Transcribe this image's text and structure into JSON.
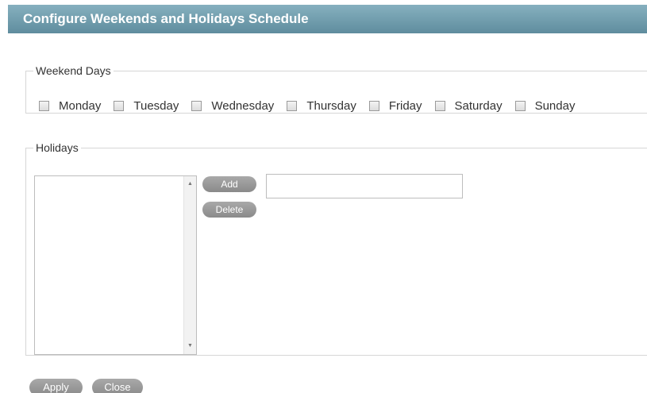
{
  "title": "Configure Weekends and Holidays Schedule",
  "weekend": {
    "legend": "Weekend Days",
    "days": [
      {
        "label": "Monday",
        "checked": false
      },
      {
        "label": "Tuesday",
        "checked": false
      },
      {
        "label": "Wednesday",
        "checked": false
      },
      {
        "label": "Thursday",
        "checked": false
      },
      {
        "label": "Friday",
        "checked": false
      },
      {
        "label": "Saturday",
        "checked": false
      },
      {
        "label": "Sunday",
        "checked": false
      }
    ]
  },
  "holidays": {
    "legend": "Holidays",
    "items": [],
    "add_label": "Add",
    "delete_label": "Delete",
    "input_value": "",
    "scroll_up_icon": "▲",
    "scroll_down_icon": "▼"
  },
  "footer": {
    "apply_label": "Apply",
    "close_label": "Close"
  },
  "colors": {
    "title_bar": "#6f9aab",
    "button": "#9b9b9b",
    "border": "#d6d6d6"
  }
}
